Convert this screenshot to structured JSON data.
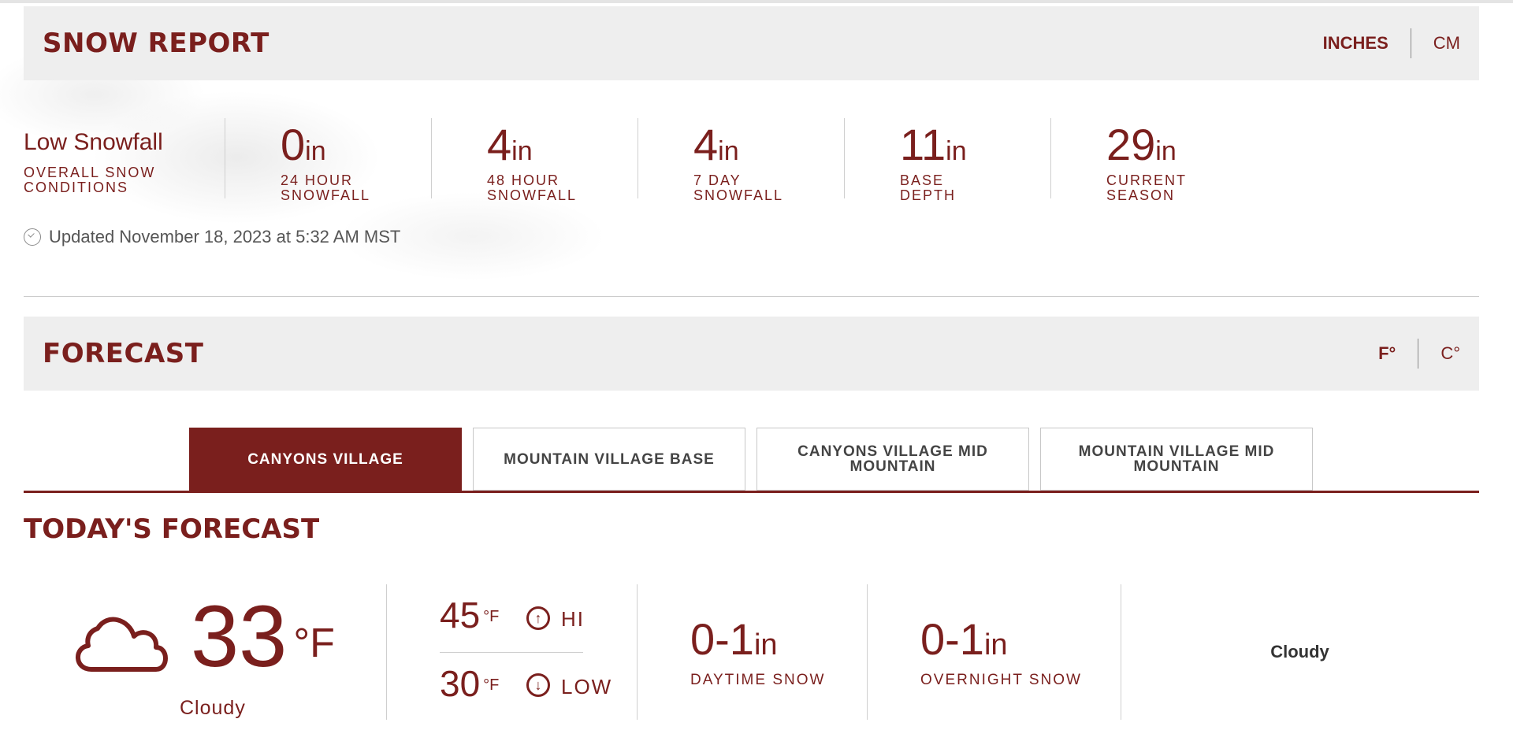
{
  "snow_report": {
    "title": "SNOW REPORT",
    "units": {
      "inches": "INCHES",
      "cm": "CM",
      "active": "inches"
    },
    "conditions": {
      "value": "Low Snowfall",
      "label": "OVERALL SNOW\nCONDITIONS"
    },
    "stats": [
      {
        "value": "0",
        "unit": "in",
        "label": "24 HOUR\nSNOWFALL"
      },
      {
        "value": "4",
        "unit": "in",
        "label": "48 HOUR\nSNOWFALL"
      },
      {
        "value": "4",
        "unit": "in",
        "label": "7 DAY\nSNOWFALL"
      },
      {
        "value": "11",
        "unit": "in",
        "label": "BASE\nDEPTH"
      },
      {
        "value": "29",
        "unit": "in",
        "label": "CURRENT\nSEASON"
      }
    ],
    "updated": "Updated November 18, 2023 at 5:32 AM MST"
  },
  "forecast": {
    "title": "FORECAST",
    "units": {
      "f": "F°",
      "c": "C°",
      "active": "f"
    },
    "tabs": [
      {
        "label": "CANYONS VILLAGE",
        "active": true
      },
      {
        "label": "MOUNTAIN VILLAGE BASE",
        "active": false
      },
      {
        "label": "CANYONS VILLAGE MID MOUNTAIN",
        "active": false
      },
      {
        "label": "MOUNTAIN VILLAGE MID MOUNTAIN",
        "active": false
      }
    ],
    "today_title": "TODAY'S FORECAST",
    "today": {
      "icon": "cloud-icon",
      "temp": "33",
      "temp_unit": "°F",
      "condition": "Cloudy",
      "hi": "45",
      "hi_unit": "°F",
      "hi_label": "HI",
      "low": "30",
      "low_unit": "°F",
      "low_label": "LOW",
      "daytime_snow": "0-1",
      "daytime_unit": "in",
      "daytime_label": "DAYTIME SNOW",
      "overnight_snow": "0-1",
      "overnight_unit": "in",
      "overnight_label": "OVERNIGHT SNOW",
      "summary": "Cloudy"
    }
  },
  "colors": {
    "brand": "#7a1f1d",
    "header_bg": "#eeeeee",
    "divider": "#cfcfcf"
  }
}
